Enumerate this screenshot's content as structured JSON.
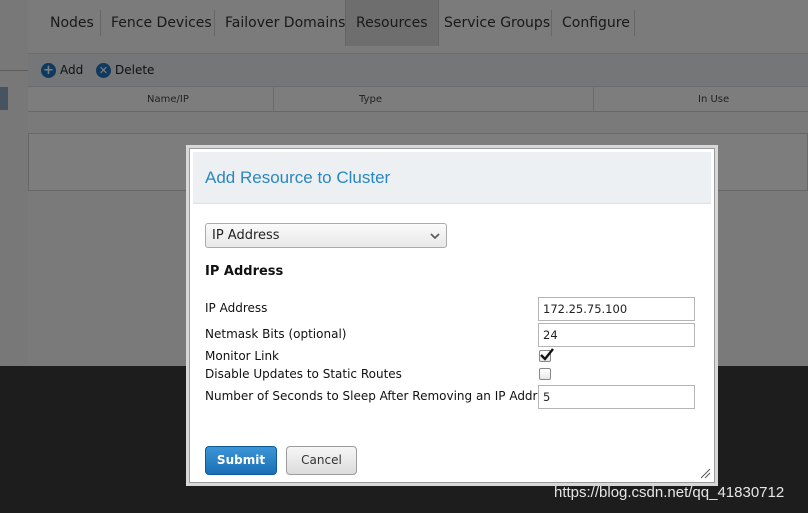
{
  "tabs": [
    {
      "label": "Nodes"
    },
    {
      "label": "Fence Devices"
    },
    {
      "label": "Failover Domains"
    },
    {
      "label": "Resources",
      "active": true
    },
    {
      "label": "Service Groups"
    },
    {
      "label": "Configure"
    }
  ],
  "toolbar": {
    "add_label": "Add",
    "delete_label": "Delete"
  },
  "table": {
    "columns": [
      "Name/IP",
      "Type",
      "In Use"
    ]
  },
  "modal": {
    "title": "Add Resource to Cluster",
    "resource_type": {
      "selected": "IP Address"
    },
    "section_title": "IP Address",
    "fields": {
      "ip_address": {
        "label": "IP Address",
        "value": "172.25.75.100"
      },
      "netmask_bits": {
        "label": "Netmask Bits (optional)",
        "value": "24"
      },
      "monitor_link": {
        "label": "Monitor Link",
        "checked": true
      },
      "disable_updates": {
        "label": "Disable Updates to Static Routes",
        "checked": false
      },
      "sleep_seconds": {
        "label": "Number of Seconds to Sleep After Removing an IP Address",
        "value": "5"
      }
    },
    "submit_label": "Submit",
    "cancel_label": "Cancel"
  },
  "watermark": "https://blog.csdn.net/qq_41830712",
  "colors": {
    "accent": "#2a87c0",
    "submit": "#1a6fb4",
    "footer_dark": "#3a3b3d"
  }
}
